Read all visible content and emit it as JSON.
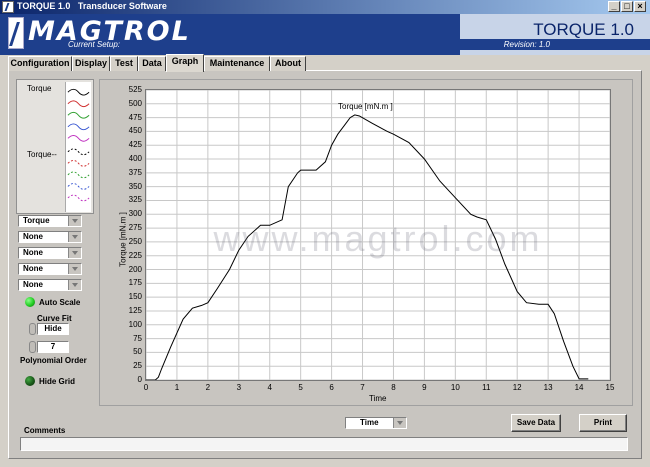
{
  "window": {
    "title": "TORQUE 1.0   Transducer Software"
  },
  "header": {
    "logo": "MAGTROL",
    "app_title": "TORQUE 1.0",
    "setup_label": "Current Setup:",
    "revision": "Revision: 1.0"
  },
  "tabs": [
    {
      "label": "Configuration"
    },
    {
      "label": "Display"
    },
    {
      "label": "Test"
    },
    {
      "label": "Data"
    },
    {
      "label": "Graph",
      "active": true
    },
    {
      "label": "Maintenance"
    },
    {
      "label": "About"
    }
  ],
  "legend": {
    "label1": "Torque",
    "label2": "Torque--"
  },
  "plot_selects": [
    "Torque",
    "None",
    "None",
    "None",
    "None"
  ],
  "controls": {
    "auto_scale": "Auto Scale",
    "curve_fit_label": "Curve Fit",
    "curve_fit_value": "Hide",
    "poly_value": "7",
    "poly_label": "Polynomial Order",
    "hide_grid": "Hide Grid"
  },
  "graph": {
    "watermark": "www.magtrol.com",
    "x_select": "Time"
  },
  "buttons": {
    "save": "Save Data",
    "print": "Print"
  },
  "comments": {
    "label": "Comments",
    "value": ""
  },
  "colors": {
    "banner": "#1e3f8c",
    "led_on": "#22cc22",
    "led_off": "#1a5a1a",
    "trace": "#000000"
  },
  "chart_data": {
    "type": "line",
    "title": "Torque [mN.m ]",
    "xlabel": "Time",
    "ylabel": "Torque [mN.m ]",
    "xlim": [
      0,
      15
    ],
    "ylim": [
      0,
      525
    ],
    "xticks": [
      0,
      1,
      2,
      3,
      4,
      5,
      6,
      7,
      8,
      9,
      10,
      11,
      12,
      13,
      14,
      15
    ],
    "yticks": [
      0,
      25,
      50,
      75,
      100,
      125,
      150,
      175,
      200,
      225,
      250,
      275,
      300,
      325,
      350,
      375,
      400,
      425,
      450,
      475,
      500,
      525
    ],
    "grid": true,
    "series": [
      {
        "name": "Torque [mN.m ]",
        "x": [
          0,
          0.3,
          0.4,
          0.5,
          0.8,
          1.2,
          1.5,
          1.8,
          2.0,
          2.3,
          2.7,
          3.0,
          3.3,
          3.6,
          3.7,
          4.0,
          4.4,
          4.6,
          4.9,
          5.0,
          5.5,
          5.8,
          6.0,
          6.2,
          6.4,
          6.6,
          6.75,
          6.9,
          7.3,
          7.8,
          8.0,
          8.5,
          9.0,
          9.5,
          10.0,
          10.5,
          10.7,
          11.0,
          11.3,
          11.6,
          12.0,
          12.3,
          12.7,
          13.0,
          13.2,
          13.5,
          13.8,
          14.0,
          14.3
        ],
        "y": [
          0,
          0,
          5,
          20,
          60,
          110,
          130,
          135,
          140,
          165,
          200,
          235,
          260,
          275,
          280,
          280,
          290,
          350,
          375,
          380,
          380,
          395,
          425,
          445,
          460,
          475,
          480,
          478,
          465,
          450,
          445,
          430,
          400,
          360,
          330,
          300,
          295,
          290,
          255,
          210,
          160,
          140,
          137,
          137,
          120,
          70,
          25,
          2,
          2
        ]
      }
    ]
  }
}
